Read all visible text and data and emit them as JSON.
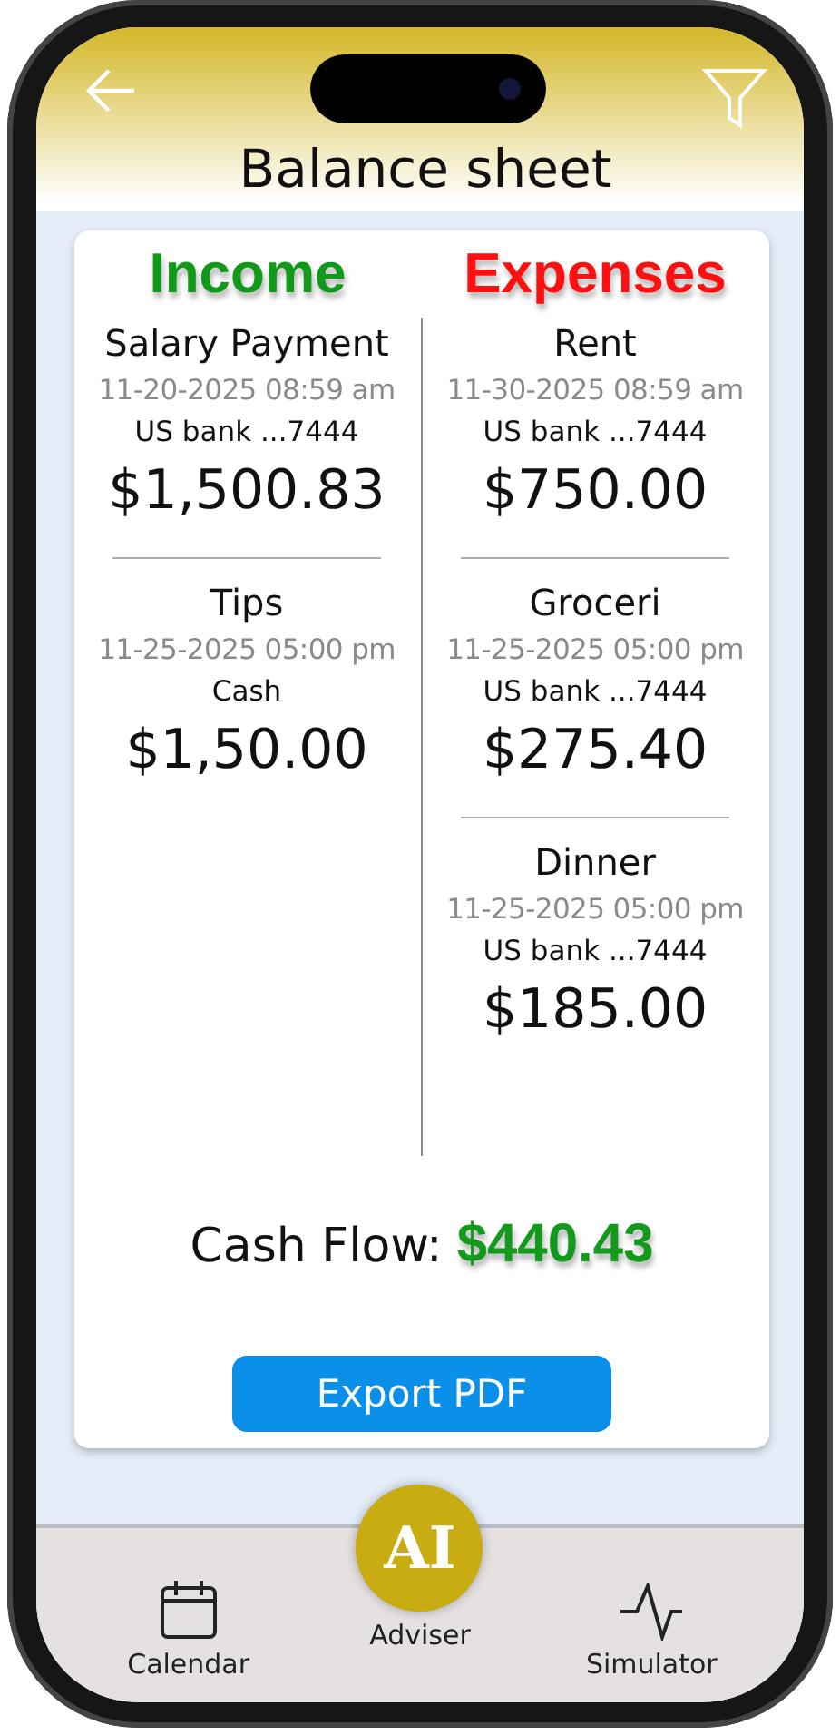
{
  "header": {
    "title": "Balance sheet"
  },
  "income": {
    "heading": "Income",
    "entries": [
      {
        "name": "Salary Payment",
        "datetime": "11-20-2025 08:59 am",
        "account": "US bank ...7444",
        "amount": "$1,500.83"
      },
      {
        "name": "Tips",
        "datetime": "11-25-2025 05:00 pm",
        "account": "Cash",
        "amount": "$1,50.00"
      }
    ]
  },
  "expenses": {
    "heading": "Expenses",
    "entries": [
      {
        "name": "Rent",
        "datetime": "11-30-2025 08:59 am",
        "account": "US bank ...7444",
        "amount": "$750.00"
      },
      {
        "name": "Groceri",
        "datetime": "11-25-2025 05:00 pm",
        "account": "US bank ...7444",
        "amount": "$275.40"
      },
      {
        "name": "Dinner",
        "datetime": "11-25-2025 05:00 pm",
        "account": "US bank ...7444",
        "amount": "$185.00"
      }
    ]
  },
  "cash_flow": {
    "label": "Cash Flow:",
    "amount": "$440.43"
  },
  "export_button": "Export PDF",
  "nav": [
    {
      "kind": "calendar",
      "label": "Calendar"
    },
    {
      "kind": "ai",
      "badge": "AI",
      "label": "Adviser"
    },
    {
      "kind": "pulse",
      "label": "Simulator"
    }
  ]
}
